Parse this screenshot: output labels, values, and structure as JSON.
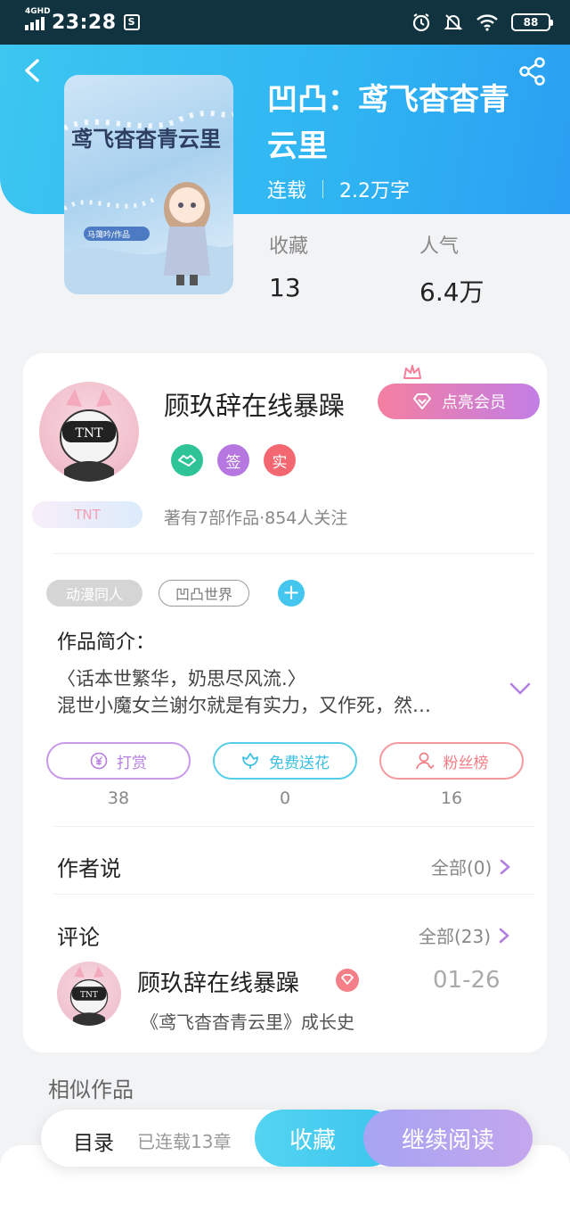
{
  "status_bar": {
    "network": "4GHD",
    "time": "23:28",
    "s_badge": "S",
    "battery": "88"
  },
  "book": {
    "title": "凹凸：鸢飞杳杳青云里",
    "status": "连载",
    "word_count": "2.2万字",
    "cover_title": "鸢飞杳杳青云里",
    "cover_author": "马蔼吟/作品",
    "favorites_label": "收藏",
    "favorites_value": "13",
    "popularity_label": "人气",
    "popularity_value": "6.4万"
  },
  "author": {
    "name": "顾玖辞在线暴躁",
    "vip_button": "点亮会员",
    "badges": [
      "签",
      "实"
    ],
    "fan_tag": "TNT",
    "stats": "著有7部作品·854人关注"
  },
  "tags": [
    "动漫同人",
    "凹凸世界"
  ],
  "intro": {
    "title": "作品简介：",
    "line1": "〈话本世繁华，奶思尽风流.〉",
    "line2": "混世小魔女兰谢尔就是有实力，又作死，然…"
  },
  "actions": [
    {
      "label": "打赏",
      "count": "38"
    },
    {
      "label": "免费送花",
      "count": "0"
    },
    {
      "label": "粉丝榜",
      "count": "16"
    }
  ],
  "author_says": {
    "title": "作者说",
    "link": "全部(0)"
  },
  "comments": {
    "title": "评论",
    "link": "全部(23)",
    "items": [
      {
        "user": "顾玖辞在线暴躁",
        "date": "01-26",
        "text": "《鸢飞杳杳青云里》成长史"
      }
    ]
  },
  "similar": {
    "title": "相似作品"
  },
  "bottom_bar": {
    "toc": "目录",
    "chapters": "已连载13章",
    "favorite": "收藏",
    "read": "继续阅读"
  },
  "colors": {
    "header": "#2fb4f2",
    "vip": "#f47fa0",
    "accent": "#44c6ef"
  }
}
